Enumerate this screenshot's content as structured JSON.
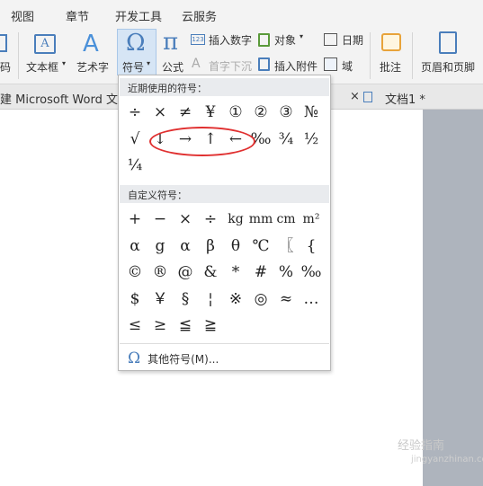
{
  "menubar": {
    "items": [
      "视图",
      "章节",
      "开发工具",
      "云服务"
    ]
  },
  "ribbon": {
    "cut_label": "码",
    "textbox_label": "文本框",
    "wordart_label": "艺术字",
    "symbol_label": "符号",
    "formula_label": "公式",
    "insert_number_label": "插入数字",
    "object_label": "对象",
    "date_label": "日期",
    "dropcap_label": "首字下沉",
    "attachment_label": "插入附件",
    "field_label": "域",
    "comment_label": "批注",
    "header_footer_label": "页眉和页脚"
  },
  "tabbar": {
    "left_tab": "建 Microsoft Word 文",
    "close_glyph": "×",
    "doc_tab": "文档1 *"
  },
  "symbol_panel": {
    "recent_header": "近期使用的符号：",
    "recent_symbols": [
      "÷",
      "×",
      "≠",
      "¥",
      "①",
      "②",
      "③",
      "№",
      "√",
      "↓",
      "→",
      "↑",
      "←",
      "‰",
      "¾",
      "½",
      "¼"
    ],
    "custom_header": "自定义符号：",
    "custom_symbols": [
      "+",
      "−",
      "×",
      "÷",
      "kg",
      "mm",
      "cm",
      "m²",
      "α",
      "g",
      "α",
      "β",
      "θ",
      "℃",
      "〖",
      "{",
      "©",
      "®",
      "@",
      "&",
      "*",
      "#",
      "%",
      "‰",
      "$",
      "￥",
      "§",
      "¦",
      "※",
      "◎",
      "≈",
      "…",
      "≤",
      "≥",
      "≦",
      "≧"
    ],
    "more_icon": "omega-icon",
    "more_label": "其他符号(M)..."
  },
  "watermark": {
    "text": "经验指南",
    "sub": "jingyanzhinan.com"
  }
}
